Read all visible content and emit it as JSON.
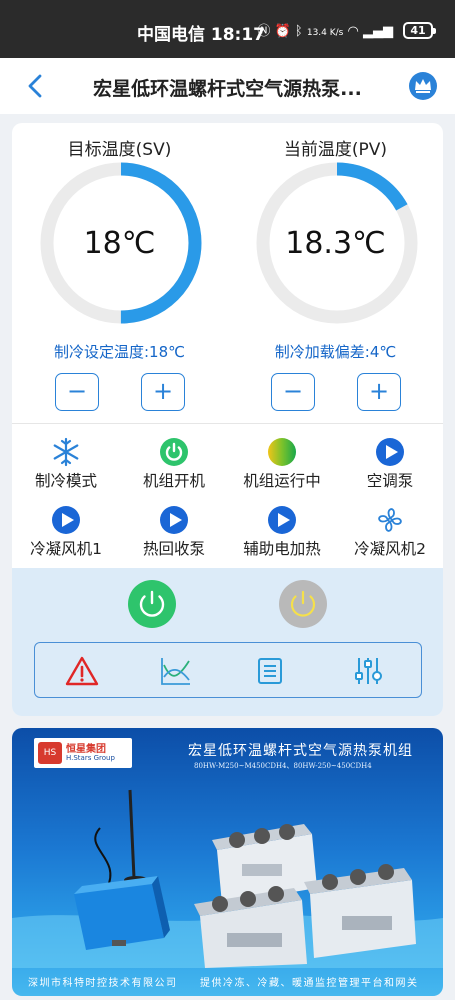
{
  "status_bar": {
    "carrier_time": "中国电信 18:17",
    "net_speed": "13.4 K/s",
    "battery": "41"
  },
  "nav": {
    "title": "宏星低环温螺杆式空气源热泵..."
  },
  "target_panel": {
    "title": "目标温度(SV)",
    "value": "18℃",
    "gauge_fraction": 0.5,
    "sub_label": "制冷设定温度:18℃",
    "minus": "−",
    "plus": "+"
  },
  "current_panel": {
    "title": "当前温度(PV)",
    "value": "18.3℃",
    "gauge_fraction": 0.17,
    "sub_label": "制冷加载偏差:4℃",
    "minus": "−",
    "plus": "+"
  },
  "status_items": [
    {
      "label": "制冷模式",
      "icon": "snowflake-icon"
    },
    {
      "label": "机组开机",
      "icon": "power-on-icon"
    },
    {
      "label": "机组运行中",
      "icon": "running-gradient-icon"
    },
    {
      "label": "空调泵",
      "icon": "play-icon"
    },
    {
      "label": "冷凝风机1",
      "icon": "play-icon"
    },
    {
      "label": "热回收泵",
      "icon": "play-icon"
    },
    {
      "label": "辅助电加热",
      "icon": "play-icon"
    },
    {
      "label": "冷凝风机2",
      "icon": "fan-icon"
    }
  ],
  "toolbar": [
    "alarm-icon",
    "trend-chart-icon",
    "list-icon",
    "settings-sliders-icon"
  ],
  "banner": {
    "logo_name": "恒星集团",
    "logo_en": "H.Stars Group",
    "title": "宏星低环温螺杆式空气源热泵机组",
    "models": "80HW-M250~M450CDH4、80HW-250~450CDH4",
    "footer_left": "深圳市科特时控技术有限公司",
    "footer_right": "提供冷冻、冷藏、暖通监控管理平台和网关"
  },
  "colors": {
    "accent": "#2a82d8",
    "gauge": "#2a9ae8",
    "power_on": "#2ec46c",
    "alarm": "#e02727"
  }
}
